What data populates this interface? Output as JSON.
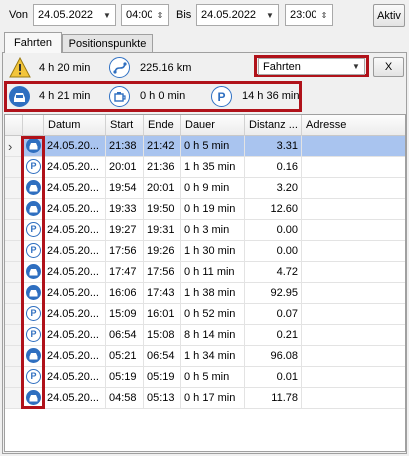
{
  "filter": {
    "from_label": "Von",
    "from_date": "24.05.2022",
    "from_time": "04:00",
    "to_label": "Bis",
    "to_date": "24.05.2022",
    "to_time": "23:00",
    "action_label": "Aktiv"
  },
  "tabs": [
    {
      "label": "Fahrten",
      "active": true
    },
    {
      "label": "Positionspunkte",
      "active": false
    }
  ],
  "summary": {
    "warning_duration": "4 h 20 min",
    "distance": "225.16 km",
    "type_select": "Fahrten",
    "clear_button": "X",
    "drive_duration": "4 h 21 min",
    "idle_duration": "0 h 0 min",
    "park_duration": "14 h 36 min"
  },
  "grid": {
    "columns": [
      "Datum",
      "Start",
      "Ende",
      "Dauer",
      "Distanz ...",
      "Adresse"
    ],
    "rows": [
      {
        "type": "drive",
        "date": "24.05.20...",
        "start": "21:38",
        "end": "21:42",
        "duration": "0 h 5 min",
        "distance": "3.31",
        "address": "",
        "selected": true
      },
      {
        "type": "park",
        "date": "24.05.20...",
        "start": "20:01",
        "end": "21:36",
        "duration": "1 h 35 min",
        "distance": "0.16",
        "address": ""
      },
      {
        "type": "drive",
        "date": "24.05.20...",
        "start": "19:54",
        "end": "20:01",
        "duration": "0 h 9 min",
        "distance": "3.20",
        "address": ""
      },
      {
        "type": "drive",
        "date": "24.05.20...",
        "start": "19:33",
        "end": "19:50",
        "duration": "0 h 19 min",
        "distance": "12.60",
        "address": ""
      },
      {
        "type": "park",
        "date": "24.05.20...",
        "start": "19:27",
        "end": "19:31",
        "duration": "0 h 3 min",
        "distance": "0.00",
        "address": ""
      },
      {
        "type": "park",
        "date": "24.05.20...",
        "start": "17:56",
        "end": "19:26",
        "duration": "1 h 30 min",
        "distance": "0.00",
        "address": ""
      },
      {
        "type": "drive",
        "date": "24.05.20...",
        "start": "17:47",
        "end": "17:56",
        "duration": "0 h 11 min",
        "distance": "4.72",
        "address": ""
      },
      {
        "type": "drive",
        "date": "24.05.20...",
        "start": "16:06",
        "end": "17:43",
        "duration": "1 h 38 min",
        "distance": "92.95",
        "address": ""
      },
      {
        "type": "park",
        "date": "24.05.20...",
        "start": "15:09",
        "end": "16:01",
        "duration": "0 h 52 min",
        "distance": "0.07",
        "address": ""
      },
      {
        "type": "park",
        "date": "24.05.20...",
        "start": "06:54",
        "end": "15:08",
        "duration": "8 h 14 min",
        "distance": "0.21",
        "address": ""
      },
      {
        "type": "drive",
        "date": "24.05.20...",
        "start": "05:21",
        "end": "06:54",
        "duration": "1 h 34 min",
        "distance": "96.08",
        "address": ""
      },
      {
        "type": "park",
        "date": "24.05.20...",
        "start": "05:19",
        "end": "05:19",
        "duration": "0 h 5 min",
        "distance": "0.01",
        "address": ""
      },
      {
        "type": "drive",
        "date": "24.05.20...",
        "start": "04:58",
        "end": "05:13",
        "duration": "0 h 17 min",
        "distance": "11.78",
        "address": ""
      }
    ]
  },
  "icons": {
    "warning": "warning-icon",
    "distance": "route-icon",
    "drive": "car-icon",
    "idle": "engine-idle-icon",
    "park": "parking-icon",
    "highlight_color": "#b0121a",
    "accent": "#2f6fc0",
    "selected_row": "#a9c4ef"
  }
}
